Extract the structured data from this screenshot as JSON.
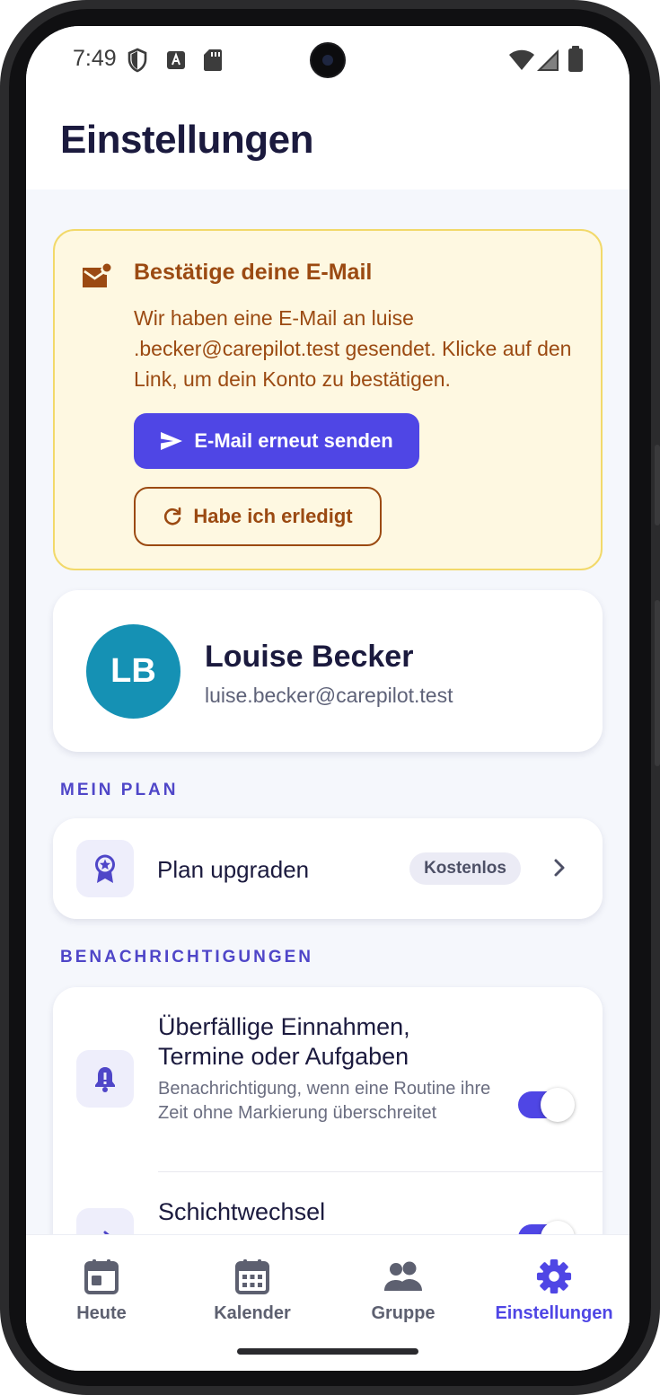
{
  "status_bar": {
    "time": "7:49",
    "left_icons": [
      "shield-icon",
      "font-a-icon",
      "sd-card-icon"
    ],
    "right_icons": [
      "wifi-icon",
      "signal-icon",
      "battery-icon"
    ]
  },
  "header": {
    "title": "Einstellungen"
  },
  "verify_email": {
    "icon": "mail-alert-icon",
    "title": "Bestätige deine E-Mail",
    "text": "Wir haben eine E-Mail an luise .becker@carepilot.test gesendet. Klicke auf den Link, um dein Konto zu bestätigen.",
    "resend_label": "E-Mail erneut senden",
    "done_label": "Habe ich erledigt",
    "colors": {
      "background": "#fef8e1",
      "border": "#f2d96a",
      "text": "#9b4a12",
      "primary": "#4f46e5"
    }
  },
  "profile": {
    "initials": "LB",
    "name": "Louise Becker",
    "email": "luise.becker@carepilot.test",
    "avatar_color": "#1591b4"
  },
  "plan": {
    "section_label": "MEIN PLAN",
    "item_label": "Plan upgraden",
    "badge": "Kostenlos",
    "icon": "award-icon"
  },
  "notifications": {
    "section_label": "BENACHRICHTIGUNGEN",
    "items": [
      {
        "title": "Überfällige Einnahmen, Termine oder Aufgaben",
        "description": "Benachrichtigung, wenn eine Routine ihre Zeit ohne Markierung überschreitet",
        "enabled": true,
        "icon": "bell-icon"
      },
      {
        "title": "Schichtwechsel",
        "description": "",
        "enabled": true,
        "icon": "swap-icon"
      }
    ]
  },
  "bottom_nav": {
    "items": [
      {
        "label": "Heute",
        "icon": "calendar-today-icon",
        "active": false
      },
      {
        "label": "Kalender",
        "icon": "calendar-month-icon",
        "active": false
      },
      {
        "label": "Gruppe",
        "icon": "group-icon",
        "active": false
      },
      {
        "label": "Einstellungen",
        "icon": "gear-icon",
        "active": true
      }
    ]
  },
  "accent_color": "#4f46e5"
}
